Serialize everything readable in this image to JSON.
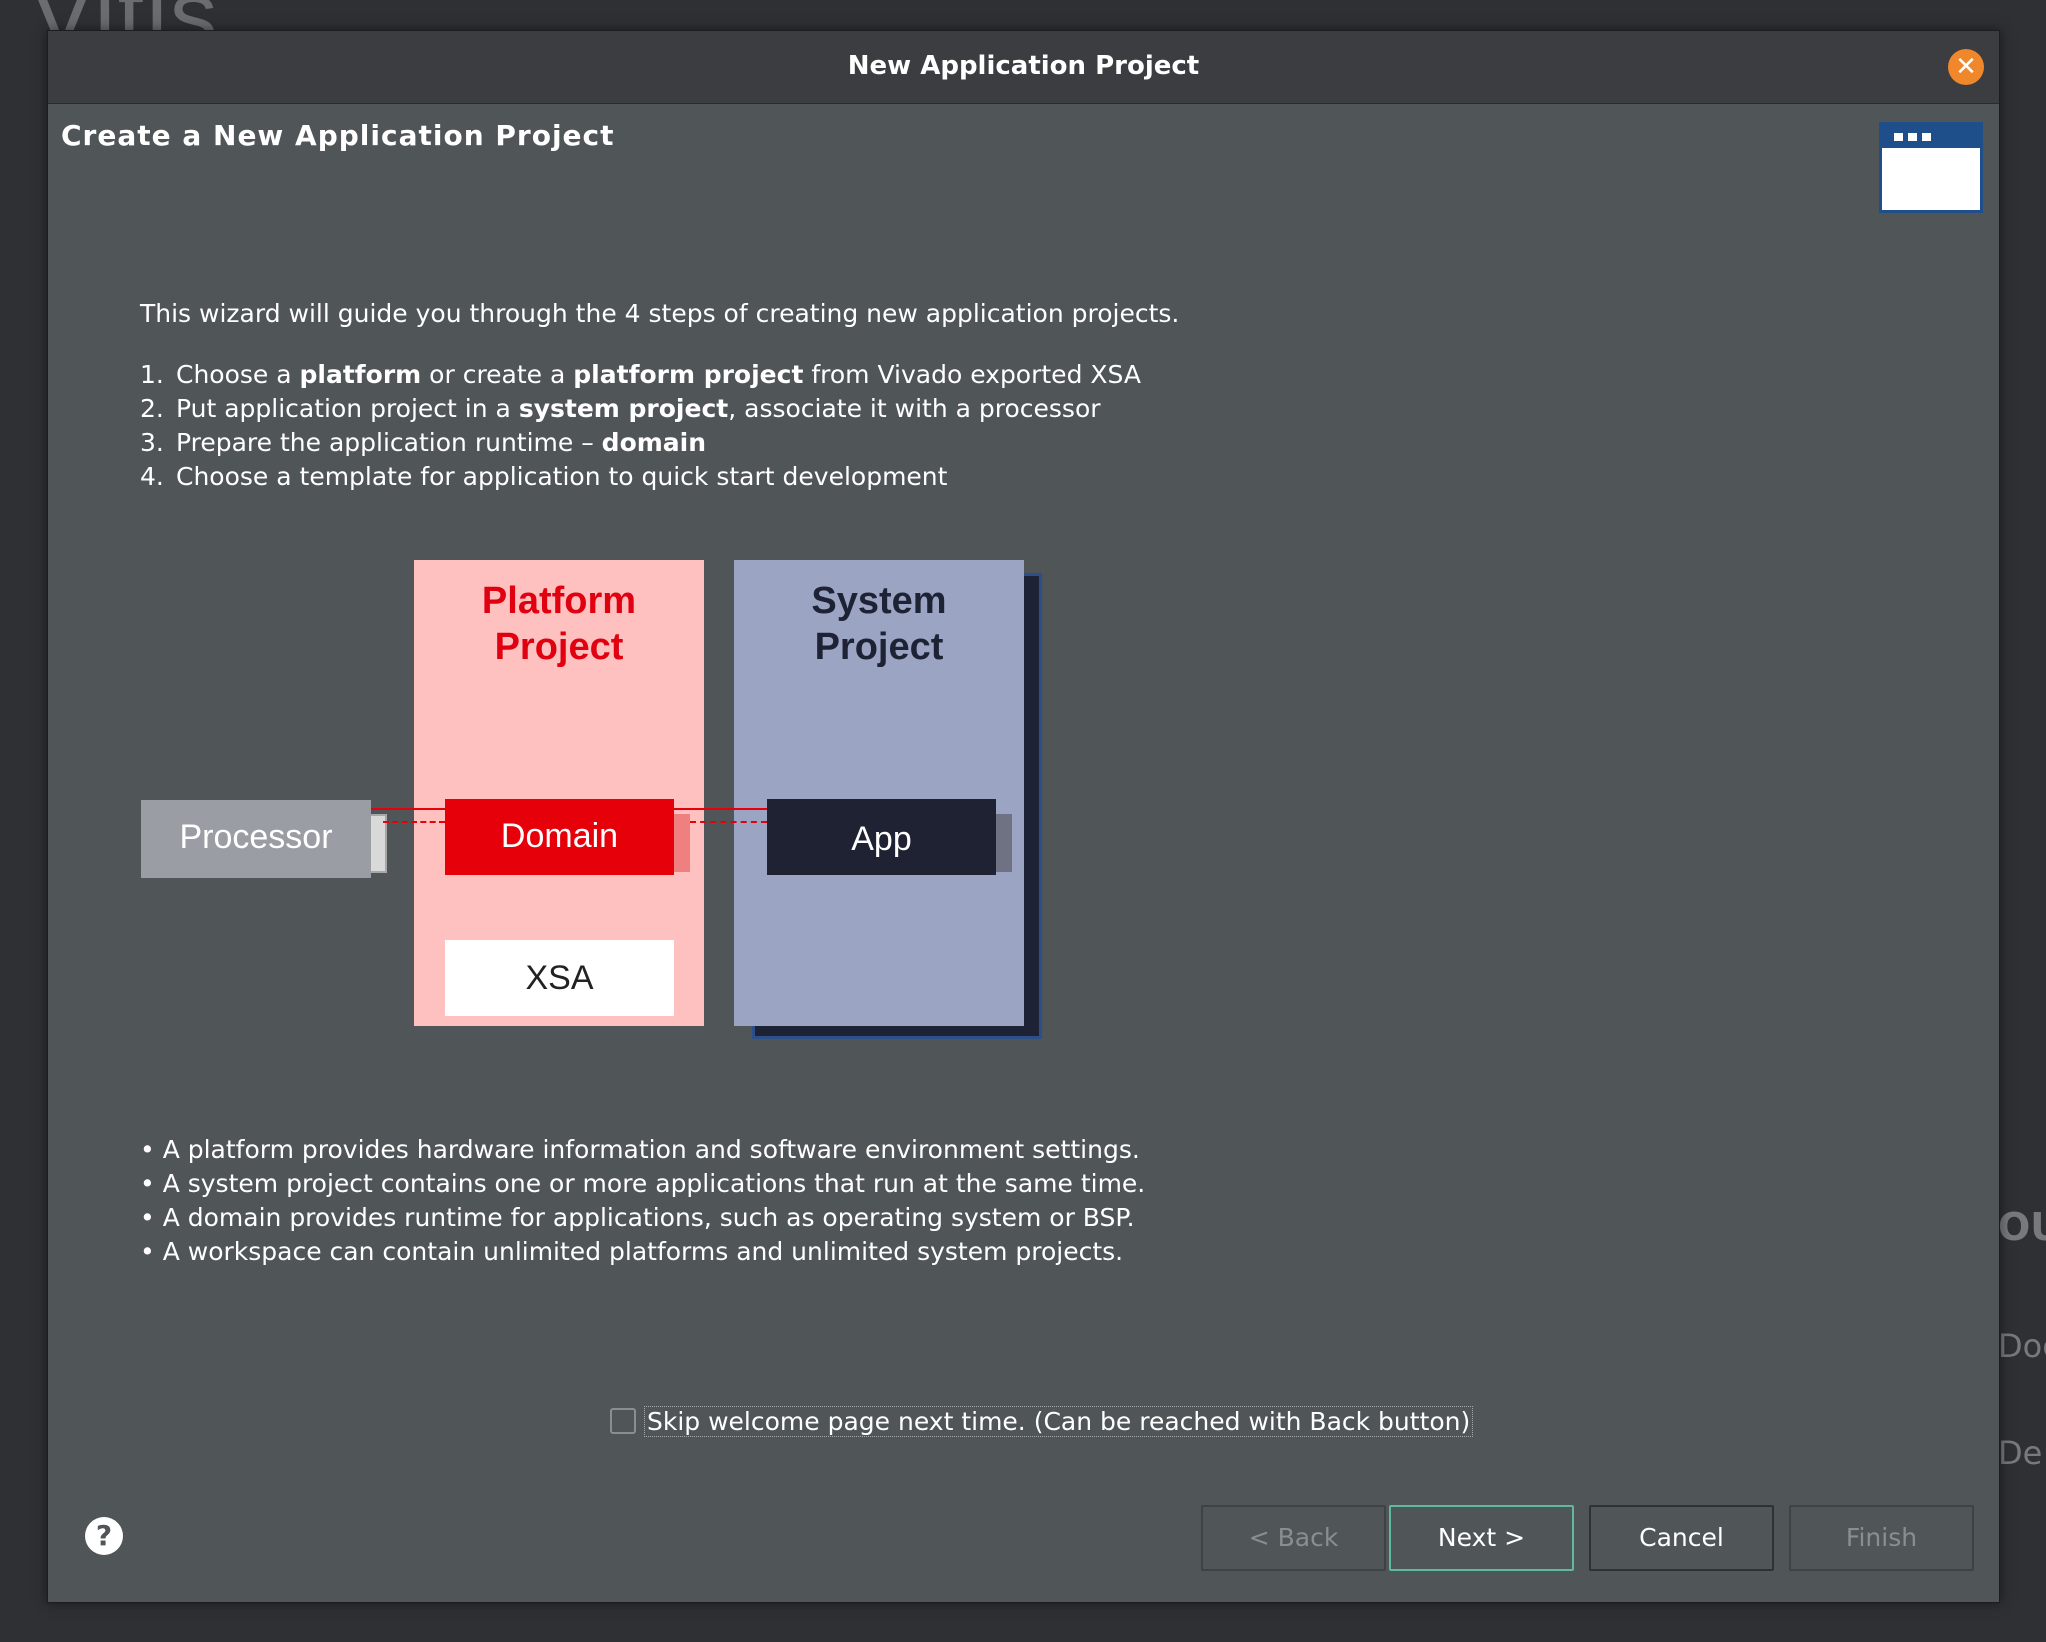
{
  "background": {
    "app_name_fragment": "Vitis",
    "right_fragments": [
      "OUI",
      "Doc",
      "De"
    ]
  },
  "dialog": {
    "title": "New Application Project",
    "close_icon": "close-icon",
    "header": "Create a New Application Project",
    "intro": "This wizard will guide you through the 4 steps of creating new application projects.",
    "steps": [
      {
        "num": "1.",
        "parts": [
          {
            "t": "Choose a ",
            "b": false
          },
          {
            "t": "platform",
            "b": true
          },
          {
            "t": " or create a ",
            "b": false
          },
          {
            "t": "platform project",
            "b": true
          },
          {
            "t": " from Vivado exported XSA",
            "b": false
          }
        ]
      },
      {
        "num": "2.",
        "parts": [
          {
            "t": "Put application project in a ",
            "b": false
          },
          {
            "t": "system project",
            "b": true
          },
          {
            "t": ", associate it with a processor",
            "b": false
          }
        ]
      },
      {
        "num": "3.",
        "parts": [
          {
            "t": "Prepare the application runtime – ",
            "b": false
          },
          {
            "t": "domain",
            "b": true
          }
        ]
      },
      {
        "num": "4.",
        "parts": [
          {
            "t": "Choose a template for application to quick start development",
            "b": false
          }
        ]
      }
    ],
    "diagram": {
      "processor": "Processor",
      "platform_title": "Platform\nProject",
      "domain": "Domain",
      "xsa": "XSA",
      "system_title": "System\nProject",
      "app": "App"
    },
    "bullets": [
      "• A platform provides hardware information and software environment settings.",
      "• A system project contains one or more applications that run at the same time.",
      "• A domain provides runtime for applications, such as operating system or BSP.",
      "• A workspace can contain unlimited platforms and unlimited system projects."
    ],
    "skip_label": "Skip welcome page next time. (Can be reached with Back button)",
    "skip_checked": false,
    "buttons": {
      "back": "< Back",
      "next": "Next >",
      "cancel": "Cancel",
      "finish": "Finish"
    },
    "help_icon": "?"
  }
}
